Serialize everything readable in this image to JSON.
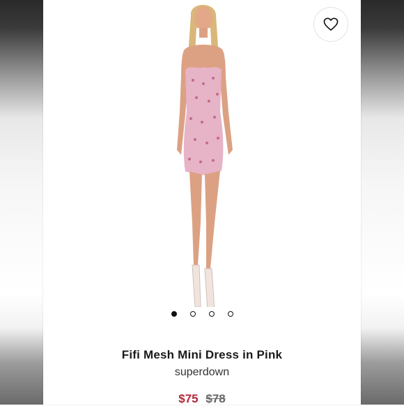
{
  "product": {
    "title": "Fifi Mesh Mini Dress in Pink",
    "brand": "superdown",
    "price_sale": "$75",
    "price_original": "$78"
  },
  "gallery": {
    "image_count": 4,
    "active_index": 0
  },
  "icons": {
    "favorite": "heart-outline-icon"
  },
  "colors": {
    "sale_price": "#b3273a",
    "dress_pink": "#e7b3c6",
    "text_dark": "#1a1a1a"
  }
}
